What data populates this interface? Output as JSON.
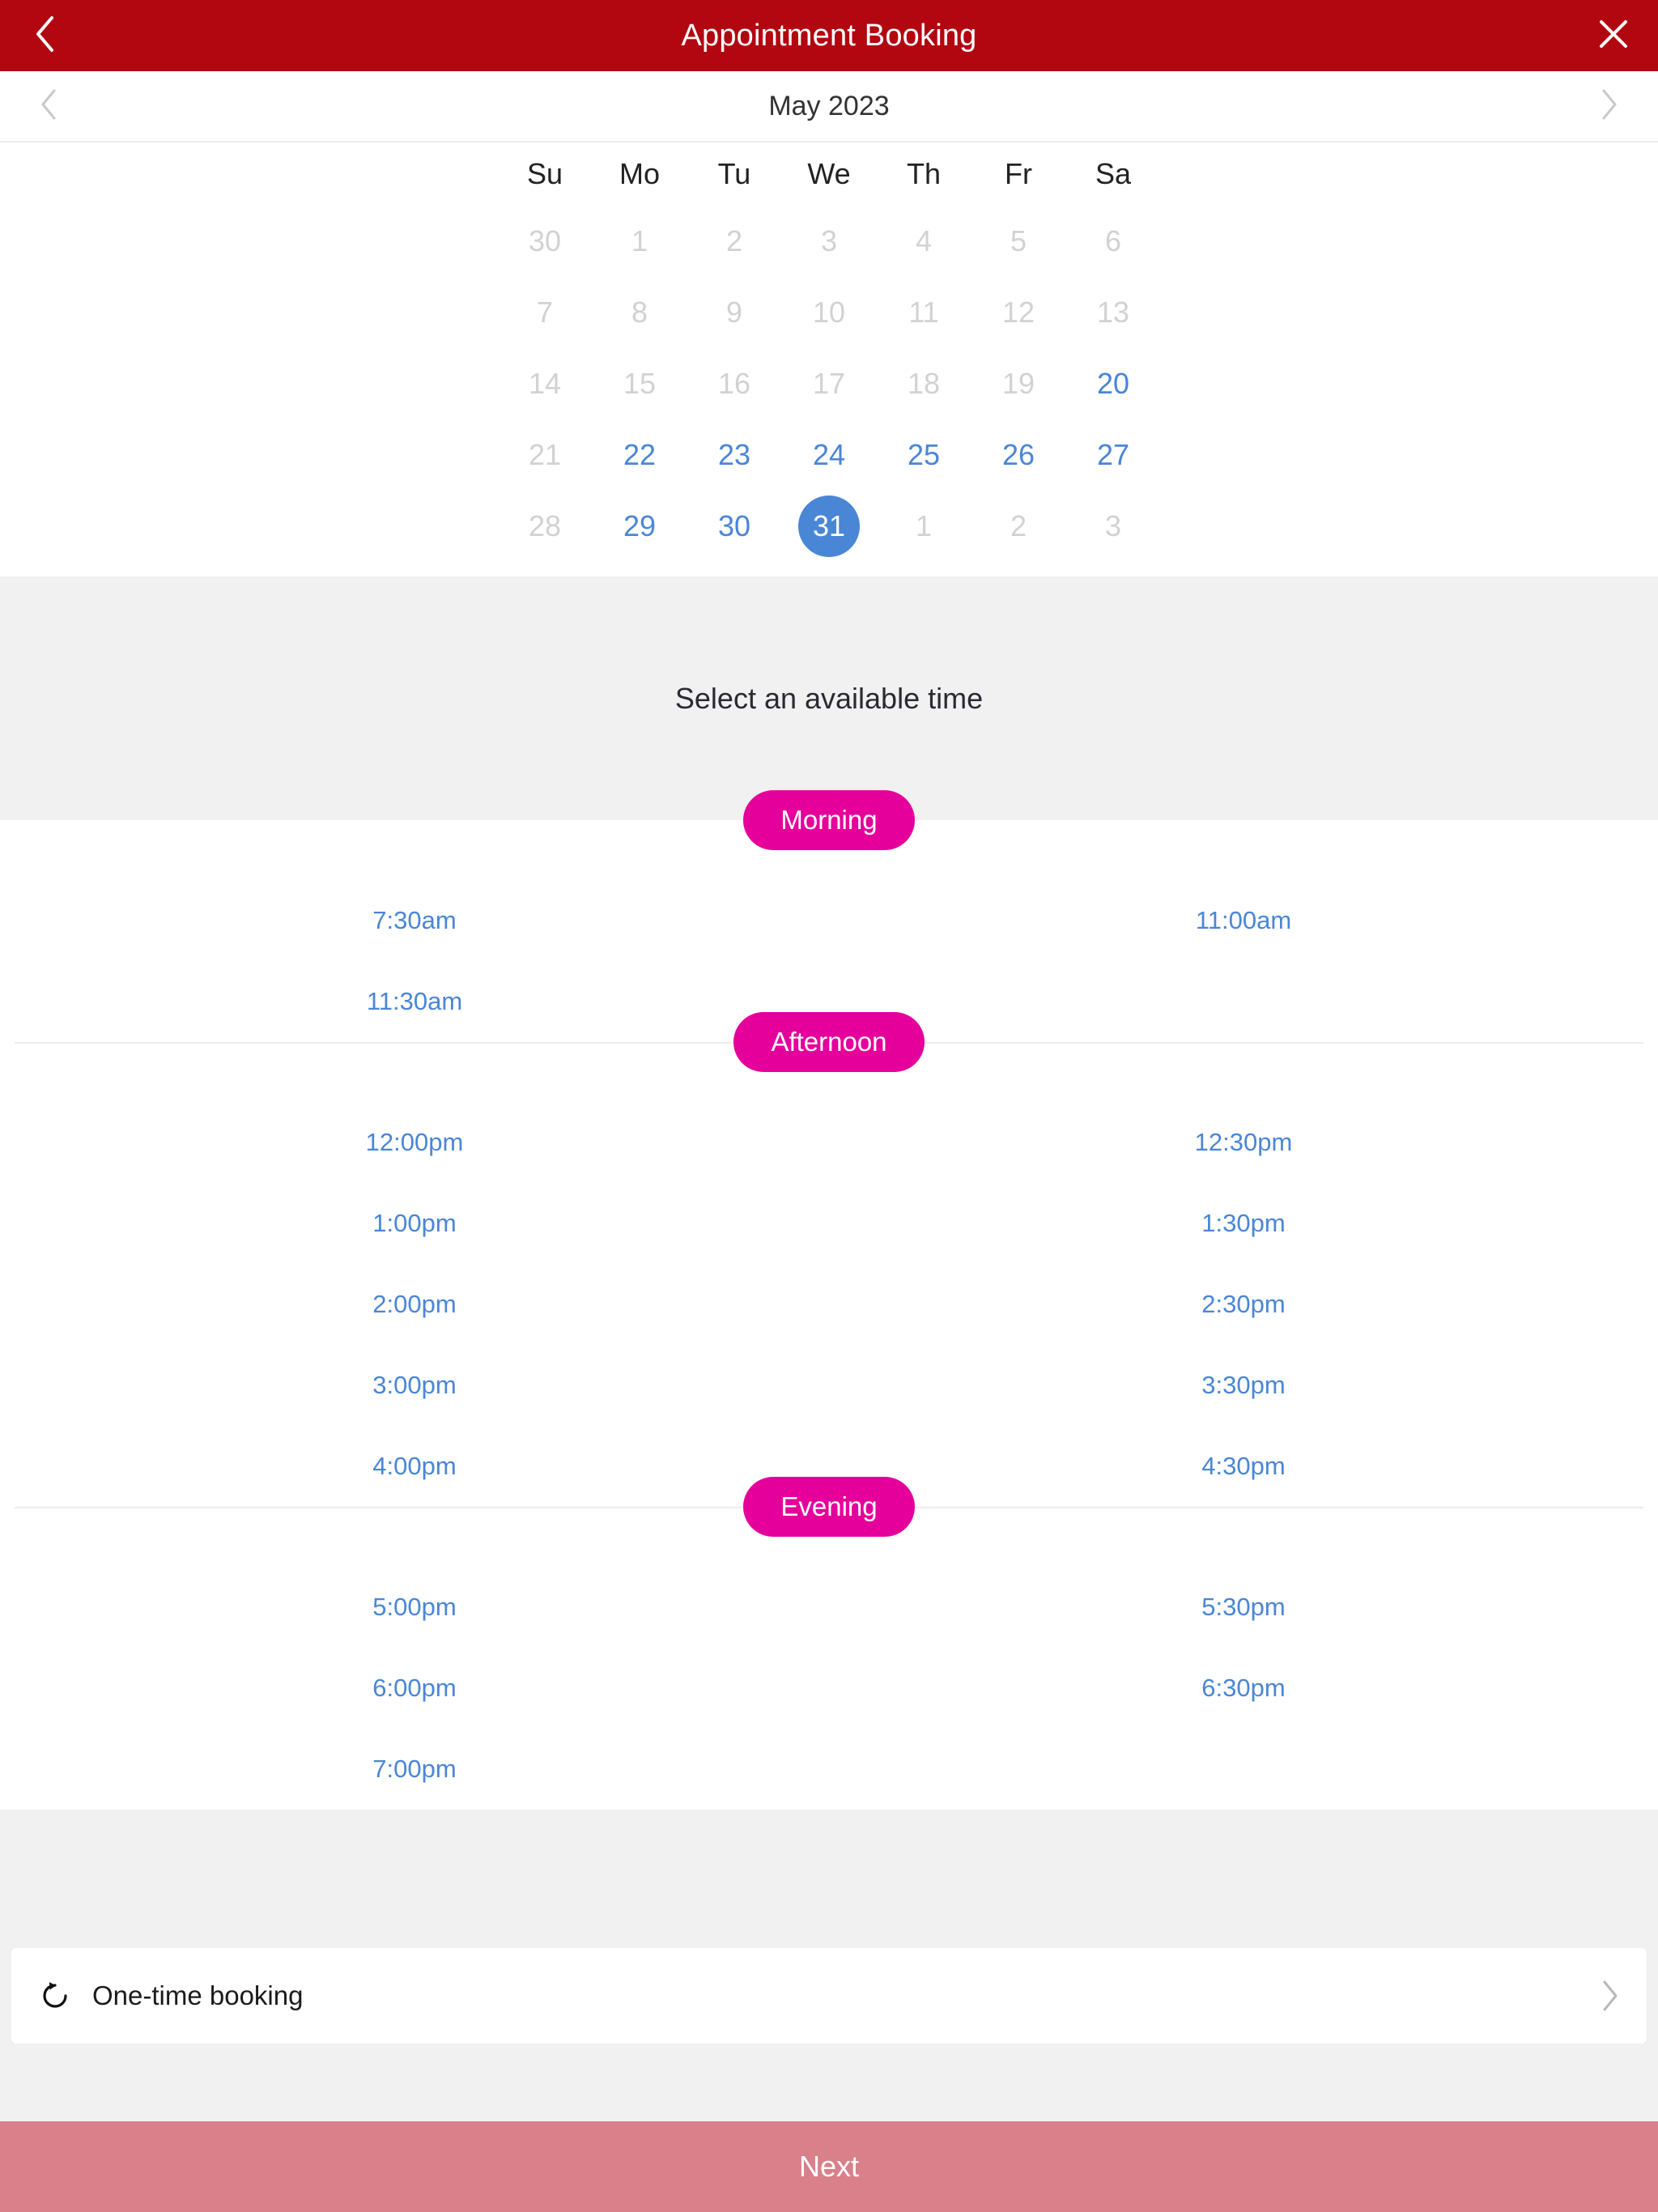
{
  "header": {
    "title": "Appointment Booking",
    "back_icon": "chevron-left-icon",
    "close_icon": "close-icon"
  },
  "month_nav": {
    "label": "May 2023",
    "prev_icon": "chevron-left-icon",
    "next_icon": "chevron-right-icon"
  },
  "calendar": {
    "weekday_headers": [
      "Su",
      "Mo",
      "Tu",
      "We",
      "Th",
      "Fr",
      "Sa"
    ],
    "selected_day": "31",
    "selected_color": "#4a86d6",
    "disabled_color": "#d2d2d2",
    "enabled_color": "#4a86d6",
    "weeks": [
      [
        {
          "label": "30",
          "state": "disabled"
        },
        {
          "label": "1",
          "state": "disabled"
        },
        {
          "label": "2",
          "state": "disabled"
        },
        {
          "label": "3",
          "state": "disabled"
        },
        {
          "label": "4",
          "state": "disabled"
        },
        {
          "label": "5",
          "state": "disabled"
        },
        {
          "label": "6",
          "state": "disabled"
        }
      ],
      [
        {
          "label": "7",
          "state": "disabled"
        },
        {
          "label": "8",
          "state": "disabled"
        },
        {
          "label": "9",
          "state": "disabled"
        },
        {
          "label": "10",
          "state": "disabled"
        },
        {
          "label": "11",
          "state": "disabled"
        },
        {
          "label": "12",
          "state": "disabled"
        },
        {
          "label": "13",
          "state": "disabled"
        }
      ],
      [
        {
          "label": "14",
          "state": "disabled"
        },
        {
          "label": "15",
          "state": "disabled"
        },
        {
          "label": "16",
          "state": "disabled"
        },
        {
          "label": "17",
          "state": "disabled"
        },
        {
          "label": "18",
          "state": "disabled"
        },
        {
          "label": "19",
          "state": "disabled"
        },
        {
          "label": "20",
          "state": "enabled"
        }
      ],
      [
        {
          "label": "21",
          "state": "disabled"
        },
        {
          "label": "22",
          "state": "enabled"
        },
        {
          "label": "23",
          "state": "enabled"
        },
        {
          "label": "24",
          "state": "enabled"
        },
        {
          "label": "25",
          "state": "enabled"
        },
        {
          "label": "26",
          "state": "enabled"
        },
        {
          "label": "27",
          "state": "enabled"
        }
      ],
      [
        {
          "label": "28",
          "state": "disabled"
        },
        {
          "label": "29",
          "state": "enabled"
        },
        {
          "label": "30",
          "state": "enabled"
        },
        {
          "label": "31",
          "state": "selected"
        },
        {
          "label": "1",
          "state": "disabled"
        },
        {
          "label": "2",
          "state": "disabled"
        },
        {
          "label": "3",
          "state": "disabled"
        }
      ]
    ]
  },
  "availability": {
    "heading": "Select an available time",
    "pill_color": "#E5009B",
    "slot_color": "#4a86d6",
    "sections": [
      {
        "label": "Morning",
        "rows": [
          [
            "7:30am",
            "11:00am"
          ],
          [
            "11:30am",
            ""
          ]
        ]
      },
      {
        "label": "Afternoon",
        "rows": [
          [
            "12:00pm",
            "12:30pm"
          ],
          [
            "1:00pm",
            "1:30pm"
          ],
          [
            "2:00pm",
            "2:30pm"
          ],
          [
            "3:00pm",
            "3:30pm"
          ],
          [
            "4:00pm",
            "4:30pm"
          ]
        ]
      },
      {
        "label": "Evening",
        "rows": [
          [
            "5:00pm",
            "5:30pm"
          ],
          [
            "6:00pm",
            "6:30pm"
          ],
          [
            "7:00pm",
            ""
          ]
        ]
      }
    ]
  },
  "recurrence": {
    "label": "One-time booking",
    "icon": "repeat-icon",
    "chevron_icon": "chevron-right-icon"
  },
  "footer": {
    "next_label": "Next",
    "next_color": "#D9808A"
  }
}
